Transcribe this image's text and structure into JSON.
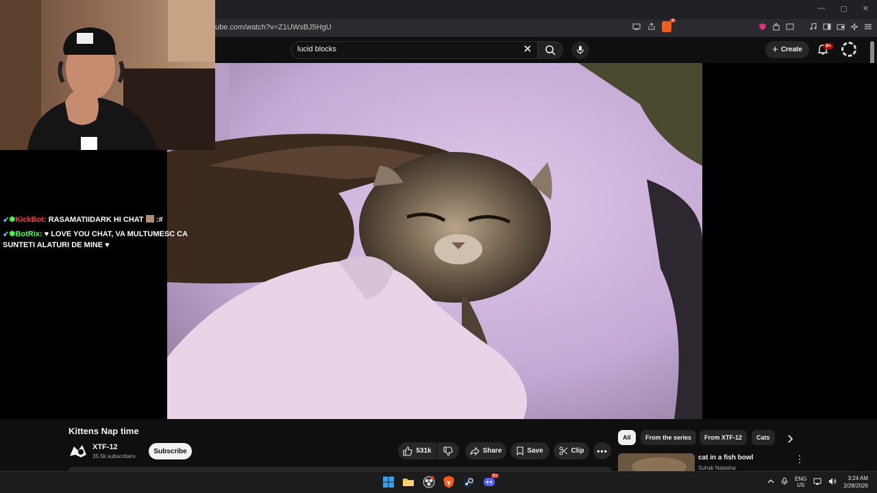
{
  "browser": {
    "url": "ube.com/watch?v=Z1UWsBJ5HgU",
    "window_controls": [
      "—",
      "▢",
      "✕"
    ]
  },
  "header": {
    "search_query": "lucid blocks",
    "create_label": "Create",
    "notifications_badge": "9+"
  },
  "stream_overlay": {
    "chat": [
      {
        "user": "KickBot:",
        "user_color": "#ff3b3b",
        "message": "RASAMATIIDARK HI CHAT",
        "suffix": ":#"
      },
      {
        "user": "BotRix:",
        "user_color": "#4cff4c",
        "message": "LOVE YOU CHAT, VA MULTUMESC CA SUNTETI ALATURI DE MINE"
      }
    ]
  },
  "video": {
    "title": "Kittens Nap time",
    "channel_name": "XTF-12",
    "subscribers": "35.5k subscribers",
    "subscribe_label": "Subscribe",
    "likes": "531k",
    "share_label": "Share",
    "save_label": "Save",
    "clip_label": "Clip"
  },
  "sidebar": {
    "chips": [
      "All",
      "From the series",
      "From XTF-12",
      "Cats"
    ],
    "recommendation": {
      "title": "cat in a fish bowl",
      "channel": "Suhak Natasha"
    }
  },
  "taskbar": {
    "lang_top": "ENG",
    "lang_bottom": "US",
    "time": "3:24 AM",
    "date": "2/28/2026",
    "discord_badge": "9+"
  },
  "colors": {
    "background": "#0f0f0f",
    "accent_red": "#cc0000",
    "chip_active": "#f1f1f1"
  }
}
